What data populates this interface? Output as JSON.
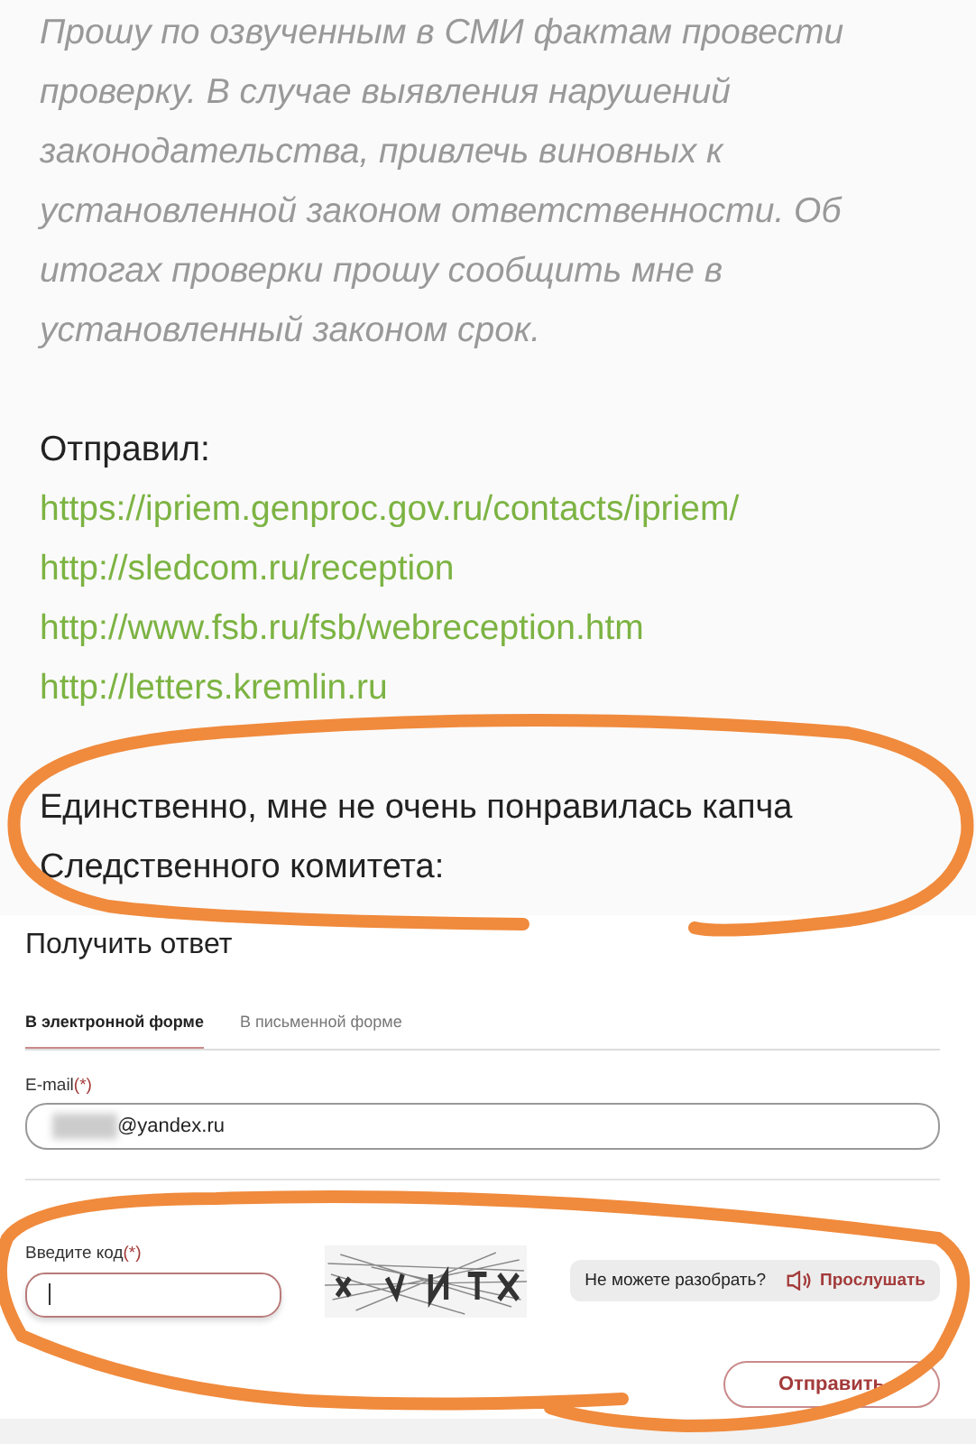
{
  "post": {
    "request_lines": [
      "Прошу по озвученным в СМИ фактам провести",
      "проверку. В случае выявления нарушений",
      "законодательства, привлечь виновных к",
      "установленной законом ответственности. Об",
      "итогах проверки прошу сообщить мне в",
      "установленный законом срок."
    ],
    "sent_label": "Отправил:",
    "links": [
      "https://ipriem.genproc.gov.ru/contacts/ipriem/",
      "http://sledcom.ru/reception",
      "http://www.fsb.ru/fsb/webreception.htm",
      "http://letters.kremlin.ru"
    ],
    "remark_lines": [
      "Единственно, мне не очень понравилась капча",
      "Следственного комитета:"
    ]
  },
  "form": {
    "title": "Получить ответ",
    "tabs": [
      {
        "label": "В электронной форме",
        "selected": true
      },
      {
        "label": "В письменной форме",
        "selected": false
      }
    ],
    "email": {
      "label": "E-mail",
      "required_mark": "(*)",
      "value": "@yandex.ru"
    },
    "code": {
      "label": "Введите код",
      "required_mark": "(*)"
    },
    "audio_hint": "Не можете разобрать?",
    "listen_link": "Прослушать",
    "submit": "Отправить"
  }
}
